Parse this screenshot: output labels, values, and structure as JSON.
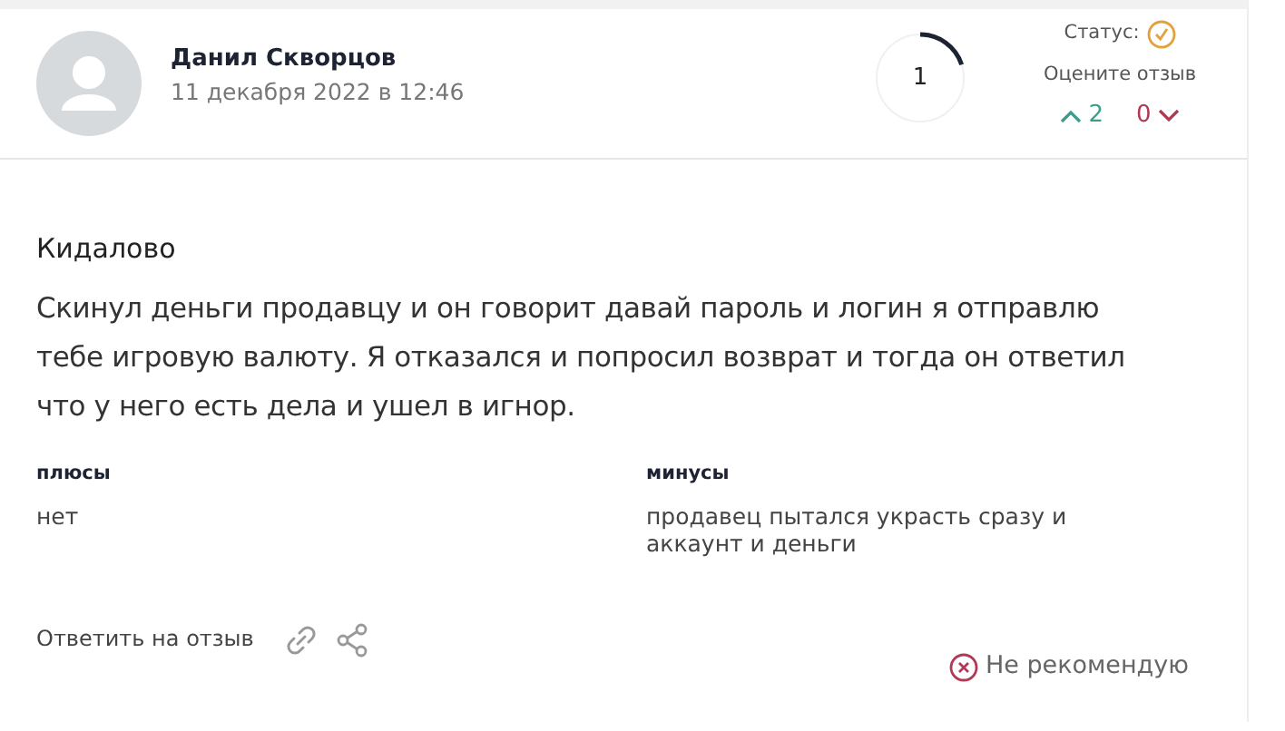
{
  "author": {
    "name": "Данил Скворцов",
    "date": "11 декабря 2022 в 12:46"
  },
  "rating": {
    "value": "1"
  },
  "status": {
    "label": "Статус:",
    "verified": true
  },
  "vote": {
    "prompt": "Оцените отзыв",
    "up": "2",
    "down": "0"
  },
  "review": {
    "title": "Кидалово",
    "text": "Скинул деньги продавцу и он говорит давай пароль и логин я отправлю тебе игровую валюту. Я отказался и попросил возврат и тогда он ответил что у него есть дела и ушел в игнор."
  },
  "pros": {
    "heading": "плюсы",
    "text": "нет"
  },
  "cons": {
    "heading": "минусы",
    "text": "продавец пытался украсть сразу и аккаунт и деньги"
  },
  "footer": {
    "reply": "Ответить на отзыв",
    "recommend": false,
    "verdict": "Не рекомендую"
  }
}
